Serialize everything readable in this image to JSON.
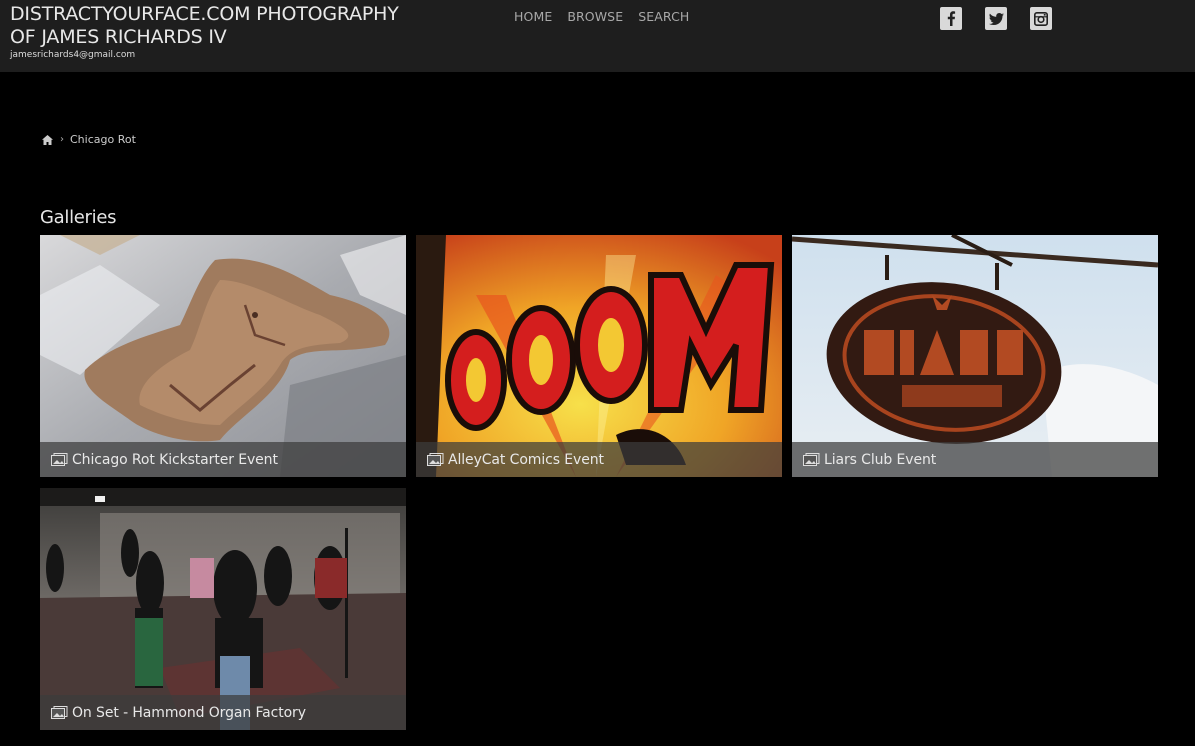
{
  "header": {
    "title": "DISTRACTYOURFACE.COM PHOTOGRAPHY OF JAMES RICHARDS IV",
    "email": "jamesrichards4@gmail.com",
    "nav": [
      "HOME",
      "BROWSE",
      "SEARCH"
    ],
    "social_icons": [
      "facebook-icon",
      "twitter-icon",
      "instagram-icon"
    ]
  },
  "breadcrumb": {
    "home_icon": "home-icon",
    "current": "Chicago Rot"
  },
  "section": {
    "title": "Galleries"
  },
  "galleries": [
    {
      "title": "Chicago Rot Kickstarter Event"
    },
    {
      "title": "AlleyCat Comics Event"
    },
    {
      "title": "Liars Club Event"
    },
    {
      "title": "On Set - Hammond Organ Factory"
    }
  ],
  "colors": {
    "background": "#000000",
    "header_bg": "#1e1e1e",
    "caption_bg": "#3c3c3c"
  }
}
